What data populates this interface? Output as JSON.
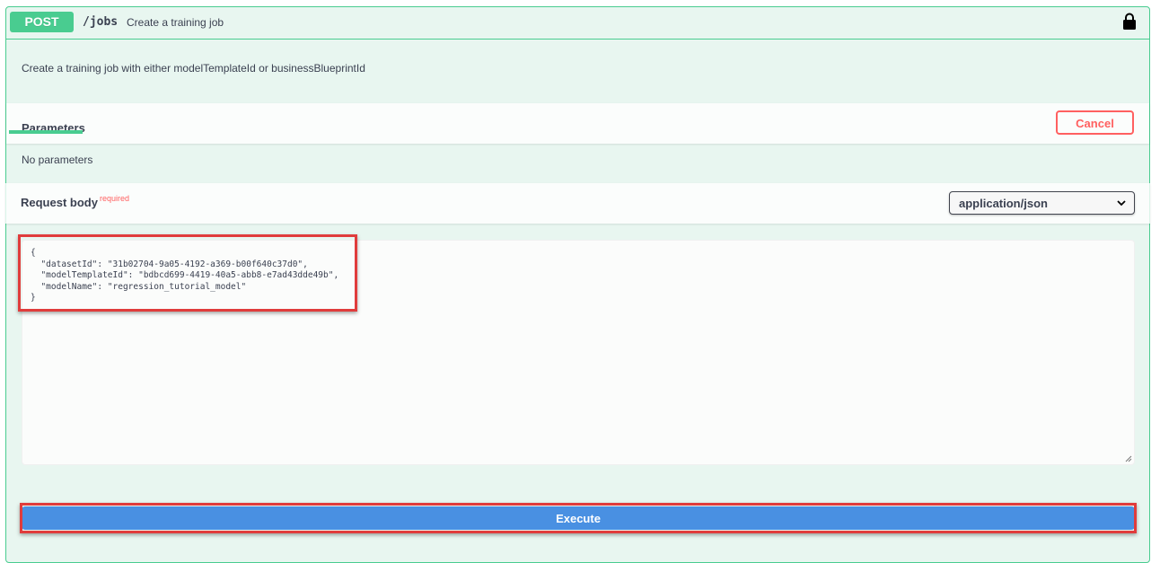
{
  "summary": {
    "method": "POST",
    "path": "/jobs",
    "path_description": "Create a training job"
  },
  "description": "Create a training job with either modelTemplateId or businessBlueprintId",
  "parameters": {
    "tab_label": "Parameters",
    "cancel_label": "Cancel",
    "empty_text": "No parameters"
  },
  "request_body": {
    "label": "Request body",
    "required_label": "required",
    "content_type": "application/json",
    "editor_value": "{\n  \"datasetId\": \"31b02704-9a05-4192-a369-b00f640c37d0\",\n  \"modelTemplateId\": \"bdbcd699-4419-40a5-abb8-e7ad43dde49b\",\n  \"modelName\": \"regression_tutorial_model\"\n}"
  },
  "execute_label": "Execute",
  "colors": {
    "post": "#49cc90",
    "execute": "#4990e2",
    "cancel": "#ff6060",
    "highlight": "#e03c3c"
  }
}
